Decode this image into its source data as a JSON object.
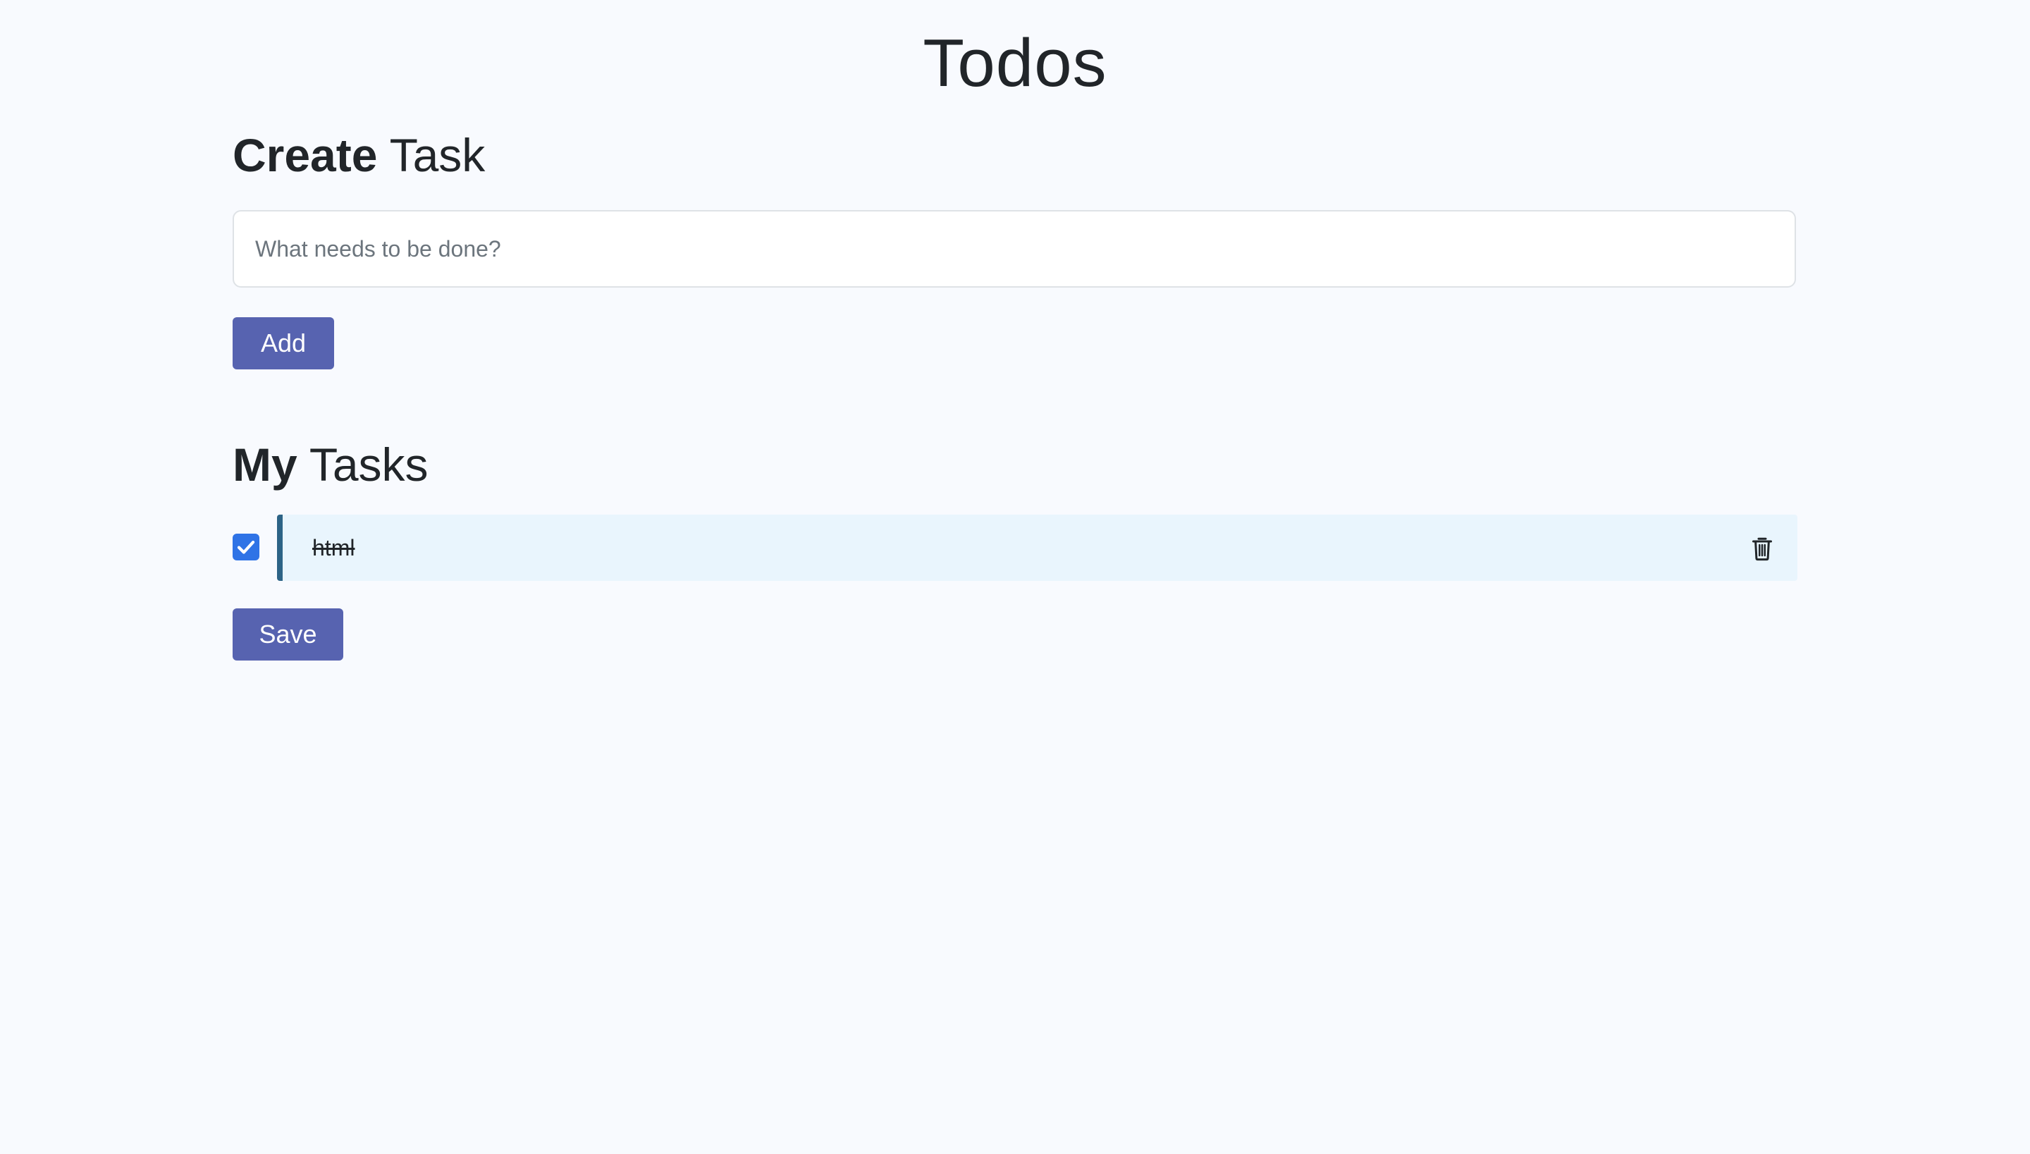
{
  "app": {
    "title": "Todos"
  },
  "create": {
    "heading_strong": "Create",
    "heading_rest": " Task",
    "input_value": "",
    "input_placeholder": "What needs to be done?",
    "add_label": "Add"
  },
  "tasks": {
    "heading_strong": "My",
    "heading_rest": " Tasks",
    "items": [
      {
        "text": "html",
        "completed": true,
        "delete_icon": "trash-icon"
      }
    ],
    "save_label": "Save"
  },
  "colors": {
    "background": "#f8fafe",
    "button": "#5763b0",
    "checkbox": "#2f73e6",
    "task_bg": "#e9f5fd",
    "task_accent": "#2c6386"
  }
}
